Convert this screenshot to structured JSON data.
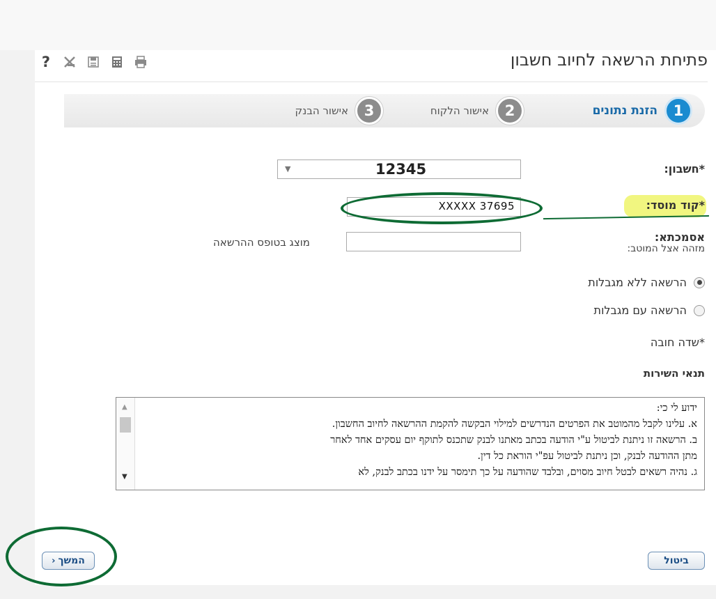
{
  "page": {
    "title": "פתיחת הרשאה לחיוב חשבון"
  },
  "toolbar": {
    "help": "?",
    "icons": [
      "close-x-icon",
      "save-icon",
      "calculator-icon",
      "print-icon"
    ]
  },
  "steps": [
    {
      "num": "1",
      "label": "הזנת נתונים",
      "active": true
    },
    {
      "num": "2",
      "label": "אישור הלקוח",
      "active": false
    },
    {
      "num": "3",
      "label": "אישור הבנק",
      "active": false
    }
  ],
  "form": {
    "account_label": "*חשבון:",
    "account_value": "12345",
    "institution_label": "*קוד מוסד:",
    "institution_value": "XXXXX   37695",
    "reference_label": "אסמכתא:",
    "reference_sublabel": "מזהה אצל המוטב:",
    "reference_note": "מוצג בטופס ההרשאה",
    "radio_unlimited": "הרשאה ללא מגבלות",
    "radio_limited": "הרשאה עם מגבלות",
    "required_note": "*שדה חובה",
    "terms_title": "תנאי השירות"
  },
  "terms": {
    "lines": [
      "ידוע לי כי:",
      "א. עלינו לקבל מהמוטב את הפרטים הנדרשים למילוי הבקשה להקמת ההרשאה לחיוב החשבון.",
      "ב. הרשאה זו ניתנת לביטול ע\"י הודעה בכתב מאתנו לבנק שתכנס לתוקף יום עסקים אחד לאחר",
      "מתן ההודעה לבנק, וכן ניתנת לביטול עפ\"י הוראת כל דין.",
      "ג. נהיה רשאים לבטל חיוב מסוים, ובלבד שהודעה על כך תימסר על ידנו בכתב לבנק, לא"
    ]
  },
  "buttons": {
    "next": "המשך",
    "cancel": "ביטול"
  },
  "colors": {
    "highlight": "#eef56a",
    "annotation": "#0e6b34",
    "step_active": "#1a8bd0"
  }
}
